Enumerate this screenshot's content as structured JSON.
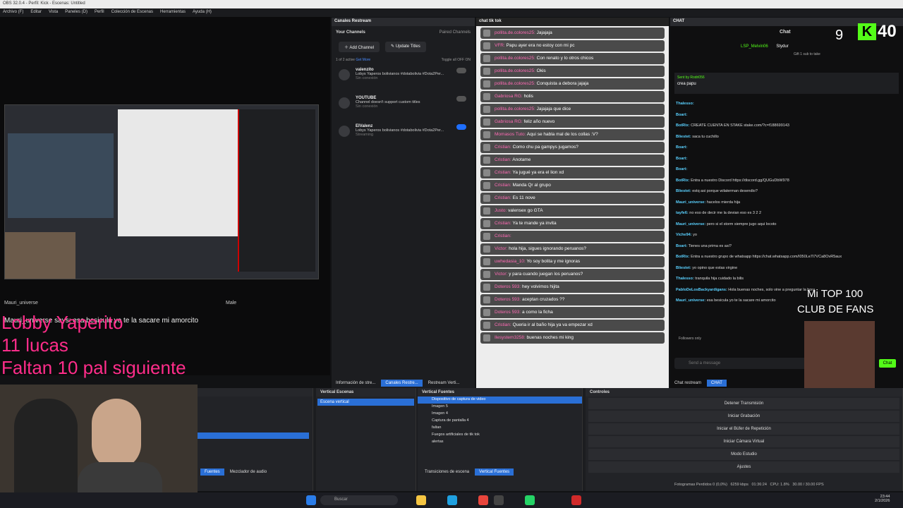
{
  "window": {
    "title": "OBS 32.0.4 - Perfil: Kick - Escenas: Untitled"
  },
  "menu": [
    "Archivo (F)",
    "Editar",
    "Vista",
    "Paneles (D)",
    "Perfil",
    "Colección de Escenas",
    "Herramientas",
    "Ayuda (H)"
  ],
  "preview": {
    "overlay": {
      "line1": "Lobby Yaperito",
      "line2": "11 lucas",
      "line3": "Faltan 10 pal siguiente"
    },
    "alert_user": "Mauri_universe",
    "alert_text": "Mauri_universe says: esa besicula yo te la sacare mi amorcito",
    "alert_gender": "Male"
  },
  "restream": {
    "panel_title": "Canales Restream",
    "your_channels": "Your Channels",
    "paired_channels": "Paired Channels",
    "add_channel": "Add Channel",
    "update_titles": "Update Titles",
    "active_count": "1 of 2 active",
    "get_more": "Get More",
    "toggle_all": "Toggle all OFF  ON",
    "channels": [
      {
        "name": "valenzito",
        "title": "Lobys Yaperos bolivianos #dotabolivia #Dota2Per...",
        "status": "Sin conexión",
        "on": false
      },
      {
        "name": "YOUTUBE",
        "title": "Channel doesn't support custom titles",
        "status": "Sin conexión",
        "on": false
      },
      {
        "name": "ElValenz",
        "title": "Lobys Yaperos bolivianos #dotabolivia #Dota2Per...",
        "status": "Streaming",
        "on": true
      }
    ],
    "tabs": [
      "Información de stre...",
      "Canales Restre...",
      "Restream Verti..."
    ]
  },
  "tiktok": {
    "panel_title": "chat tik tok",
    "messages": [
      {
        "user": "pollita.de.colores25:",
        "text": "Jajajaja"
      },
      {
        "user": "VFR:",
        "text": "Papu ayer era no estoy con mi pc"
      },
      {
        "user": "pollita.de.colores25:",
        "text": "Con renato y lo otros chicos"
      },
      {
        "user": "pollita.de.colores25:",
        "text": "Okis"
      },
      {
        "user": "pollita.de.colores25:",
        "text": "Conquista a debora jajaja"
      },
      {
        "user": "Gabriosa RG:",
        "text": "holis"
      },
      {
        "user": "pollita.de.colores25:",
        "text": "Jajajaja que dice"
      },
      {
        "user": "Gabriosa RG:",
        "text": "feliz año nuevo"
      },
      {
        "user": "Momasos Tuto:",
        "text": "Aqui se habla mal de los collas :V?"
      },
      {
        "user": "Cristian:",
        "text": "Como chu pa gampys jugamos?"
      },
      {
        "user": "Cristian:",
        "text": "Anotame"
      },
      {
        "user": "Cristian:",
        "text": "Ya jugué ya era el lion xd"
      },
      {
        "user": "Cristian:",
        "text": "Manda Qr al grupo"
      },
      {
        "user": "Cristian:",
        "text": "Es 11 nove"
      },
      {
        "user": "Justo:",
        "text": "valensex go GTA"
      },
      {
        "user": "Cristian:",
        "text": "Ya te mande ya invita"
      },
      {
        "user": "Cristian:",
        "text": ""
      },
      {
        "user": "Victor:",
        "text": "hola hija, sigues ignorando peruanos?"
      },
      {
        "user": "uwhedasia_10:",
        "text": "Yo soy bolita y me ignoras"
      },
      {
        "user": "Victor:",
        "text": "y para cuando juegan los peruanos?"
      },
      {
        "user": "Doteros 593:",
        "text": "hey volvimos hijita"
      },
      {
        "user": "Doteros 593:",
        "text": "aceptan cruzados ??"
      },
      {
        "user": "Doteros 593:",
        "text": "a como la ficha"
      },
      {
        "user": "Cristian:",
        "text": "Queria ir al baño hija ya va empezar xd"
      },
      {
        "user": "Ilesystem3258:",
        "text": "buenas noches mi king"
      }
    ]
  },
  "chat": {
    "panel_title": "CHAT",
    "header": "Chat",
    "viewers": "9",
    "kick_count": "40",
    "top_gifter": "LSP_Melvin06",
    "gifter2": "Stydur",
    "gift_note": "Gift 1 sub to take",
    "pinned_by": "Sent by Rodri056",
    "pinned_text": "crea papu",
    "lines": [
      {
        "user": "Thalesso:",
        "text": ""
      },
      {
        "user": "Boart:",
        "text": ""
      },
      {
        "user": "BotRix:",
        "text": "CREATE CUENTA EN STAKE stake.com/?c=f188699143"
      },
      {
        "user": "Bliestet:",
        "text": "saca tu cuchillo"
      },
      {
        "user": "Boart:",
        "text": ""
      },
      {
        "user": "Boart:",
        "text": ""
      },
      {
        "user": "Boart:",
        "text": ""
      },
      {
        "user": "BotRix:",
        "text": "Entra a nuestro Discord https://discord.gg/QUGuDbW978"
      },
      {
        "user": "Bliestet:",
        "text": "estq asi porque wilaterman desendio?"
      },
      {
        "user": "Mauri_universe:",
        "text": "hacelos mierda hija"
      },
      {
        "user": "tayfe6:",
        "text": "no eso de decir me la devian eso es 3 2 2"
      },
      {
        "user": "Mauri_universe:",
        "text": "pero si el storm siempre jugo aqui locoto"
      },
      {
        "user": "Viche94:",
        "text": "yo"
      },
      {
        "user": "Boart:",
        "text": "Tienes una prima es asi?"
      },
      {
        "user": "BotRix:",
        "text": "Entra a nuestro grupo de whatsapp https://chat.whatsapp.com/I050Le7I7VCa8OvR5aux"
      },
      {
        "user": "Bliestet:",
        "text": "yo opino que estas virgine"
      },
      {
        "user": "Thalesso:",
        "text": "tranquila hija cuidado la bilis"
      },
      {
        "user": "PabloDeLosBackyardigans:",
        "text": "Hola buenas noches, solo vine a preguntar la hora"
      },
      {
        "user": "Mauri_universe:",
        "text": "esa besicula yo te la sacare mi amorcito"
      }
    ],
    "followers_only": "Followers only",
    "send_placeholder": "Send a message",
    "send_label": "Chat",
    "overlay_top": "Mi TOP 100",
    "overlay_bottom": "CLUB DE FANS",
    "tabs": [
      "Chat restream",
      "CHAT"
    ]
  },
  "dock": {
    "scenes": {
      "title": "Vertical Escenas",
      "items": [
        "Escena vertical"
      ]
    },
    "sources": {
      "title": "Vertical Fuentes",
      "items": [
        "Dispositivo de captura de video",
        "Imagen 5",
        "Imagen 4",
        "Captura de pantalla 4",
        "faltan",
        "Fuegos artificiales de tik tok",
        "alertas",
        ""
      ]
    },
    "controls": {
      "title": "Controles",
      "buttons": [
        "Detener Transmisión",
        "Iniciar Grabación",
        "Iniciar el Búfer de Repetición",
        "Iniciar Cámara Virtual",
        "Modo Estudio",
        "Ajustes"
      ]
    },
    "tabs_left": [
      "Fuentes",
      "Mezclador de audio"
    ],
    "tabs_mid": [
      "Transiciones de escena",
      "Vertical Fuentes"
    ],
    "status": {
      "frames": "Fotogramas Perdidos 0 (0,0%)",
      "kbps": "6259 kbps",
      "time": "01:36:24",
      "cpu": "CPU: 1.8%",
      "fps": "30.00 / 30.00 FPS"
    }
  },
  "taskbar": {
    "search": "Buscar",
    "clock": "23:44",
    "date": "2/1/2026"
  },
  "colors": {
    "accent": "#2a6fd6",
    "kick": "#53fc18",
    "overlay_pink": "#ff2d8a"
  }
}
